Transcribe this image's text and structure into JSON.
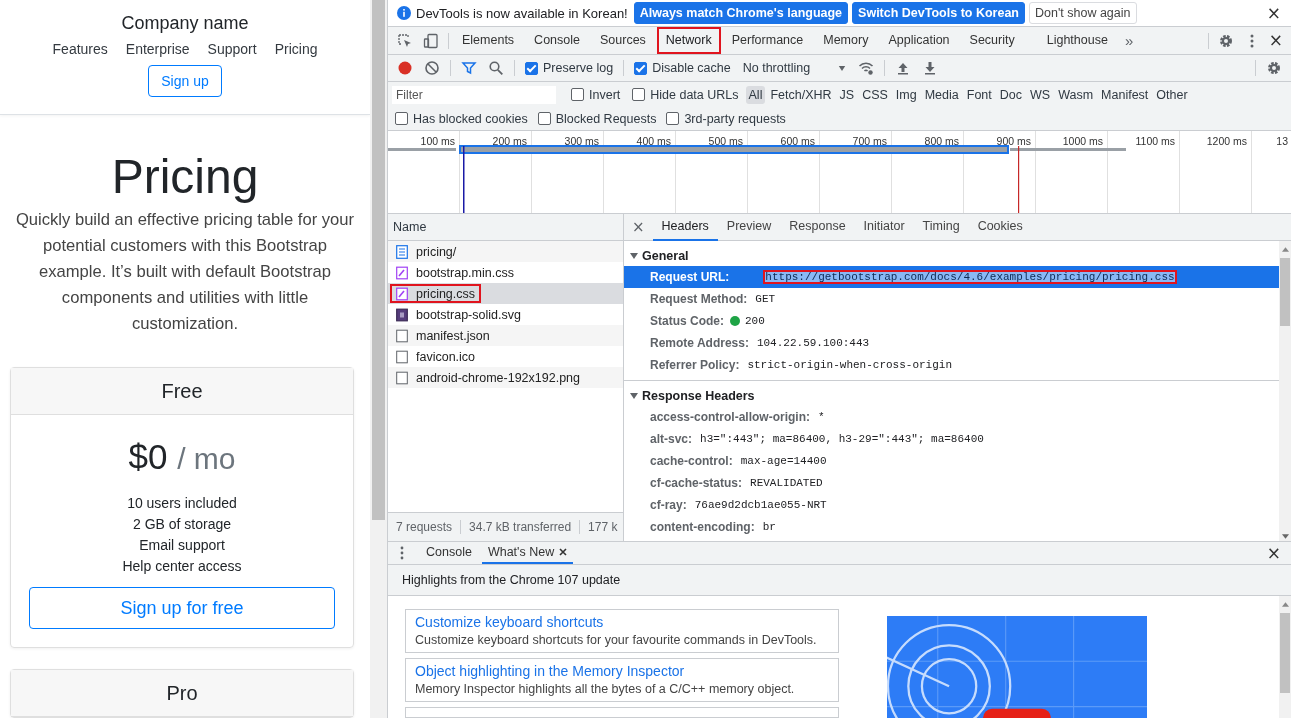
{
  "page": {
    "brand": "Company name",
    "nav": [
      "Features",
      "Enterprise",
      "Support",
      "Pricing"
    ],
    "signup": "Sign up",
    "title": "Pricing",
    "lead": "Quickly build an effective pricing table for your potential customers with this Bootstrap example. It’s built with default Bootstrap components and utilities with little customization.",
    "cards": [
      {
        "title": "Free",
        "price": "$0",
        "period": "/ mo",
        "features": [
          "10 users included",
          "2 GB of storage",
          "Email support",
          "Help center access"
        ],
        "button": "Sign up for free"
      },
      {
        "title": "Pro"
      }
    ]
  },
  "devtools": {
    "infobar": {
      "message": "DevTools is now available in Korean!",
      "buttons": [
        {
          "label": "Always match Chrome's language",
          "kind": "primary"
        },
        {
          "label": "Switch DevTools to Korean",
          "kind": "primary"
        },
        {
          "label": "Don't show again",
          "kind": "plain"
        }
      ],
      "close": "×"
    },
    "tabs": [
      {
        "label": "Elements",
        "selected": false,
        "annotated": false
      },
      {
        "label": "Console",
        "selected": false,
        "annotated": false
      },
      {
        "label": "Sources",
        "selected": false,
        "annotated": false
      },
      {
        "label": "Network",
        "selected": true,
        "annotated": true
      },
      {
        "label": "Performance",
        "selected": false,
        "annotated": false
      },
      {
        "label": "Memory",
        "selected": false,
        "annotated": false
      },
      {
        "label": "Application",
        "selected": false,
        "annotated": false
      },
      {
        "label": "Security",
        "selected": false,
        "annotated": false
      },
      {
        "label": "Lighthouse",
        "selected": false,
        "annotated": false
      }
    ],
    "more_tabs": "»",
    "close": "×",
    "toolbar": {
      "recording": true,
      "preserve_log": {
        "label": "Preserve log",
        "checked": true
      },
      "disable_cache": {
        "label": "Disable cache",
        "checked": true
      },
      "throttling": "No throttling"
    },
    "filter": {
      "placeholder": "Filter",
      "options": [
        {
          "label": "Invert",
          "checked": false
        },
        {
          "label": "Hide data URLs",
          "checked": false
        }
      ],
      "types": [
        {
          "label": "All",
          "selected": true
        },
        {
          "label": "Fetch/XHR",
          "selected": false
        },
        {
          "label": "JS",
          "selected": false
        },
        {
          "label": "CSS",
          "selected": false
        },
        {
          "label": "Img",
          "selected": false
        },
        {
          "label": "Media",
          "selected": false
        },
        {
          "label": "Font",
          "selected": false
        },
        {
          "label": "Doc",
          "selected": false
        },
        {
          "label": "WS",
          "selected": false
        },
        {
          "label": "Wasm",
          "selected": false
        },
        {
          "label": "Manifest",
          "selected": false
        },
        {
          "label": "Other",
          "selected": false
        }
      ],
      "extra": [
        {
          "label": "Has blocked cookies",
          "checked": false
        },
        {
          "label": "Blocked Requests",
          "checked": false
        },
        {
          "label": "3rd-party requests",
          "checked": false
        }
      ]
    },
    "timeline": {
      "ticks": [
        "100 ms",
        "200 ms",
        "300 ms",
        "400 ms",
        "500 ms",
        "600 ms",
        "700 ms",
        "800 ms",
        "900 ms",
        "1000 ms",
        "1100 ms",
        "1200 ms",
        "13"
      ]
    },
    "requests": {
      "header": "Name",
      "rows": [
        {
          "name": "pricing/",
          "kind": "doc",
          "selected": false,
          "annotated": false
        },
        {
          "name": "bootstrap.min.css",
          "kind": "css",
          "selected": false,
          "annotated": false
        },
        {
          "name": "pricing.css",
          "kind": "css",
          "selected": true,
          "annotated": true
        },
        {
          "name": "bootstrap-solid.svg",
          "kind": "img",
          "selected": false,
          "annotated": false
        },
        {
          "name": "manifest.json",
          "kind": "other",
          "selected": false,
          "annotated": false
        },
        {
          "name": "favicon.ico",
          "kind": "other",
          "selected": false,
          "annotated": false
        },
        {
          "name": "android-chrome-192x192.png",
          "kind": "other",
          "selected": false,
          "annotated": false
        }
      ],
      "summary": [
        "7 requests",
        "34.7 kB transferred",
        "177 k"
      ]
    },
    "details": {
      "close": "×",
      "tabs": [
        {
          "label": "Headers",
          "selected": true
        },
        {
          "label": "Preview",
          "selected": false
        },
        {
          "label": "Response",
          "selected": false
        },
        {
          "label": "Initiator",
          "selected": false
        },
        {
          "label": "Timing",
          "selected": false
        },
        {
          "label": "Cookies",
          "selected": false
        }
      ],
      "sections": [
        {
          "title": "General",
          "expanded": true,
          "rows": [
            {
              "key": "Request URL:",
              "value": "https://getbootstrap.com/docs/4.6/examples/pricing/pricing.css",
              "selected": true,
              "annotated": true
            },
            {
              "key": "Request Method:",
              "value": "GET",
              "selected": false,
              "annotated": false
            },
            {
              "key": "Status Code:",
              "value": "200",
              "selected": false,
              "annotated": false,
              "color": "#1ea446"
            },
            {
              "key": "Remote Address:",
              "value": "104.22.59.100:443",
              "selected": false,
              "annotated": false
            },
            {
              "key": "Referrer Policy:",
              "value": "strict-origin-when-cross-origin",
              "selected": false,
              "annotated": false
            }
          ]
        },
        {
          "title": "Response Headers",
          "expanded": true,
          "rows": [
            {
              "key": "access-control-allow-origin:",
              "value": "*",
              "selected": false,
              "annotated": false
            },
            {
              "key": "alt-svc:",
              "value": "h3=\":443\"; ma=86400, h3-29=\":443\"; ma=86400",
              "selected": false,
              "annotated": false
            },
            {
              "key": "cache-control:",
              "value": "max-age=14400",
              "selected": false,
              "annotated": false
            },
            {
              "key": "cf-cache-status:",
              "value": "REVALIDATED",
              "selected": false,
              "annotated": false
            },
            {
              "key": "cf-ray:",
              "value": "76ae9d2dcb1ae055-NRT",
              "selected": false,
              "annotated": false
            },
            {
              "key": "content-encoding:",
              "value": "br",
              "selected": false,
              "annotated": false
            }
          ]
        }
      ]
    },
    "drawer": {
      "tabs": [
        {
          "label": "Console",
          "selected": false,
          "closable": false
        },
        {
          "label": "What's New",
          "selected": true,
          "closable": true
        }
      ],
      "close": "×",
      "title": "Highlights from the Chrome 107 update",
      "items": [
        {
          "title": "Customize keyboard shortcuts",
          "description": "Customize keyboard shortcuts for your favourite commands in DevTools."
        },
        {
          "title": "Object highlighting in the Memory Inspector",
          "description": "Memory Inspector highlights all the bytes of a C/C++ memory object."
        }
      ]
    }
  }
}
